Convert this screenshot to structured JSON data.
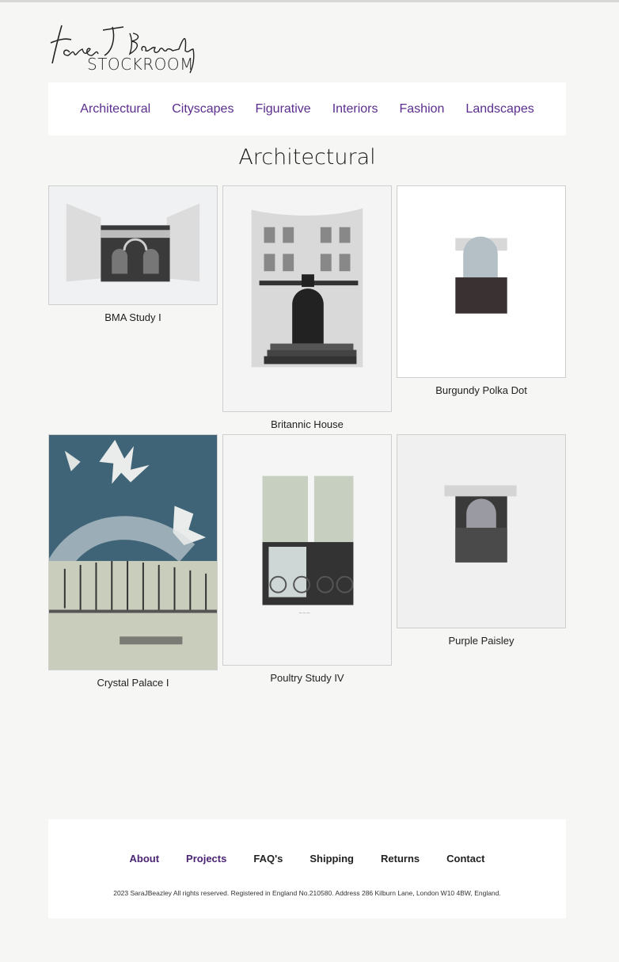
{
  "brand": {
    "signature": "Sara J Beazley",
    "sub": "STOCKROOM"
  },
  "nav": [
    {
      "label": "Architectural"
    },
    {
      "label": "Cityscapes"
    },
    {
      "label": "Figurative"
    },
    {
      "label": "Interiors"
    },
    {
      "label": "Fashion"
    },
    {
      "label": "Landscapes"
    }
  ],
  "page": {
    "title": "Architectural"
  },
  "gallery": [
    {
      "title": "BMA Study I"
    },
    {
      "title": "Britannic House"
    },
    {
      "title": "Burgundy Polka Dot"
    },
    {
      "title": "Crystal Palace I"
    },
    {
      "title": "Poultry Study IV"
    },
    {
      "title": "Purple Paisley"
    }
  ],
  "footer": {
    "links": [
      {
        "label": "About"
      },
      {
        "label": "Projects"
      },
      {
        "label": "FAQ's"
      },
      {
        "label": "Shipping"
      },
      {
        "label": "Returns"
      },
      {
        "label": "Contact"
      }
    ],
    "copyright": "2023 SaraJBeazley All rights reserved. Registered in England No.210580. Address 286 Kilburn Lane, London W10 4BW, England."
  },
  "colors": {
    "accent": "#5b2d8e",
    "background": "#f6f6f4"
  }
}
